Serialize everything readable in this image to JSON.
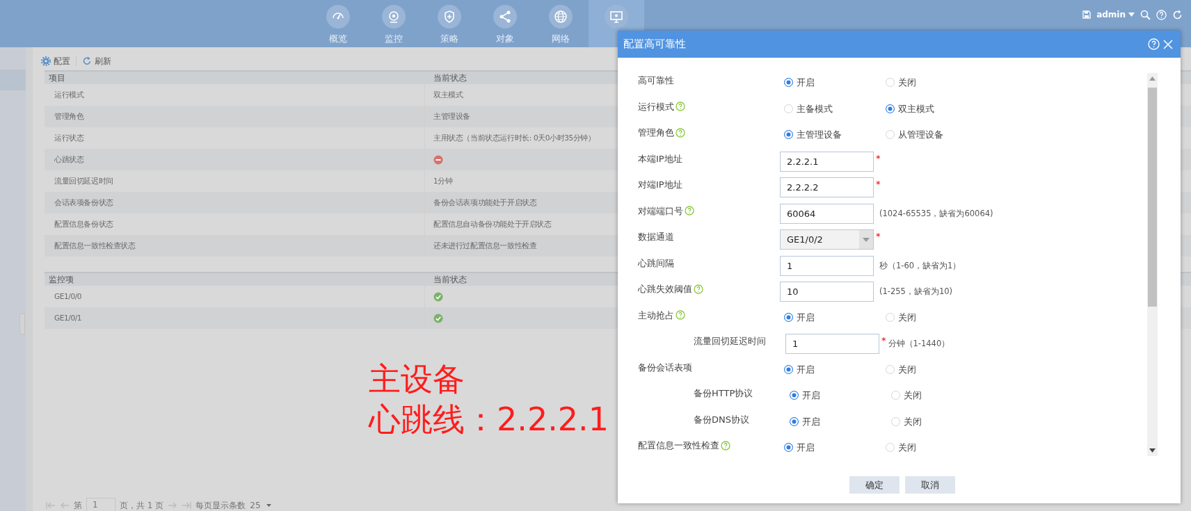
{
  "top_nav": {
    "items": [
      {
        "label": "概览",
        "selected": false
      },
      {
        "label": "监控",
        "selected": false
      },
      {
        "label": "策略",
        "selected": false
      },
      {
        "label": "对象",
        "selected": false
      },
      {
        "label": "网络",
        "selected": false
      },
      {
        "selected": true
      }
    ],
    "user": "admin"
  },
  "toolbar": [
    {
      "label": "配置"
    },
    {
      "label": "刷新"
    }
  ],
  "status_table": {
    "columns": [
      "项目",
      "当前状态"
    ],
    "rows": [
      {
        "kind": "text",
        "item": "运行模式",
        "status": "双主模式"
      },
      {
        "kind": "text",
        "item": "管理角色",
        "status": "主管理设备"
      },
      {
        "kind": "text",
        "item": "运行状态",
        "status": "主用状态（当前状态运行时长: 0天0小时35分钟）"
      },
      {
        "kind": "error",
        "item": "心跳状态"
      },
      {
        "kind": "text",
        "item": "流量回切延迟时间",
        "status": "1分钟"
      },
      {
        "kind": "text",
        "item": "会话表项备份状态",
        "status": "备份会话表项功能处于开启状态"
      },
      {
        "kind": "text",
        "item": "配置信息备份状态",
        "status": "配置信息自动备份功能处于开启状态"
      },
      {
        "kind": "text",
        "item": "配置信息一致性检查状态",
        "status": "还未进行过配置信息一致性检查"
      }
    ]
  },
  "monitor_table": {
    "columns": [
      "监控项",
      "当前状态"
    ],
    "rows": [
      {
        "kind": "ok",
        "item": "GE1/0/0"
      },
      {
        "kind": "ok",
        "item": "GE1/0/1"
      }
    ]
  },
  "annotation": [
    "主设备",
    "心跳线：2.2.2.1"
  ],
  "pagination": {
    "page_prefix": "第",
    "page": "1",
    "page_suffix": "页，共 1 页",
    "per_page_label": "每页显示条数",
    "per_page": "25"
  },
  "dialog": {
    "title": "配置高可靠性",
    "fields": [
      {
        "kind": "radio",
        "label": "高可靠性",
        "help": false,
        "options": [
          {
            "label": "开启",
            "selected": true
          },
          {
            "label": "关闭",
            "selected": false
          }
        ]
      },
      {
        "kind": "radio",
        "label": "运行模式",
        "help": true,
        "options": [
          {
            "label": "主备模式",
            "selected": false
          },
          {
            "label": "双主模式",
            "selected": true
          }
        ]
      },
      {
        "kind": "radio",
        "label": "管理角色",
        "help": true,
        "options": [
          {
            "label": "主管理设备",
            "selected": true
          },
          {
            "label": "从管理设备",
            "selected": false
          }
        ]
      },
      {
        "kind": "input",
        "label": "本端IP地址",
        "help": false,
        "value": "2.2.2.1",
        "required_mark": "*"
      },
      {
        "kind": "input",
        "label": "对端IP地址",
        "help": false,
        "value": "2.2.2.2",
        "required_mark": "*"
      },
      {
        "kind": "input",
        "label": "对端端口号",
        "help": true,
        "value": "60064",
        "hint": "(1024-65535，缺省为60064)"
      },
      {
        "kind": "select",
        "label": "数据通道",
        "help": false,
        "value": "GE1/0/2",
        "required_mark": "*"
      },
      {
        "kind": "input",
        "label": "心跳间隔",
        "help": false,
        "value": "1",
        "hint": "秒（1-60，缺省为1）"
      },
      {
        "kind": "input",
        "label": "心跳失效阈值",
        "help": true,
        "value": "10",
        "hint": "(1-255，缺省为10)"
      },
      {
        "kind": "radio",
        "label": "主动抢占",
        "help": true,
        "options": [
          {
            "label": "开启",
            "selected": true
          },
          {
            "label": "关闭",
            "selected": false
          }
        ],
        "children": [
          {
            "kind": "input",
            "label": "流量回切延迟时间",
            "help": false,
            "value": "1",
            "required_mark": "*",
            "hint": "分钟（1-1440）"
          }
        ]
      },
      {
        "kind": "radio",
        "label": "备份会话表项",
        "help": false,
        "options": [
          {
            "label": "开启",
            "selected": true
          },
          {
            "label": "关闭",
            "selected": false
          }
        ],
        "children": [
          {
            "kind": "radio",
            "label": "备份HTTP协议",
            "help": false,
            "options": [
              {
                "label": "开启",
                "selected": true
              },
              {
                "label": "关闭",
                "selected": false
              }
            ]
          },
          {
            "kind": "radio",
            "label": "备份DNS协议",
            "help": false,
            "options": [
              {
                "label": "开启",
                "selected": true
              },
              {
                "label": "关闭",
                "selected": false
              }
            ]
          }
        ]
      },
      {
        "kind": "radio",
        "label": "配置信息一致性检查",
        "help": true,
        "options": [
          {
            "label": "开启",
            "selected": true
          },
          {
            "label": "关闭",
            "selected": false
          }
        ]
      }
    ],
    "buttons": [
      "确定",
      "取消"
    ]
  }
}
